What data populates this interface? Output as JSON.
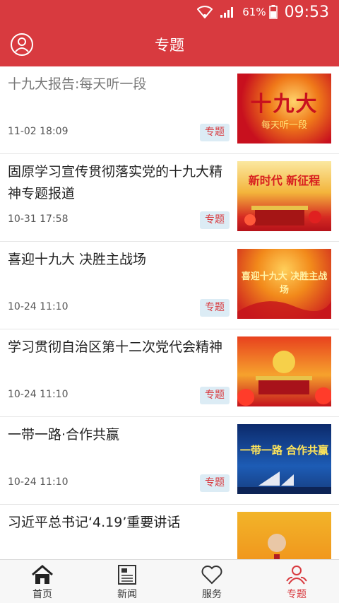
{
  "status_bar": {
    "battery_percent": "61%",
    "time": "09:53"
  },
  "header": {
    "title": "专题"
  },
  "thumb_text": {
    "t1_big": "十九大",
    "t1_small": "每天听一段",
    "t2_big": "新时代 新征程",
    "t3_big": "喜迎十九大 决胜主战场",
    "t5_big": "一带一路 合作共赢"
  },
  "articles": [
    {
      "title": "十九大报告:每天听一段",
      "date": "11-02 18:09",
      "tag": "专题",
      "read": true
    },
    {
      "title": "固原学习宣传贯彻落实党的十九大精神专题报道",
      "date": "10-31 17:58",
      "tag": "专题",
      "read": false
    },
    {
      "title": "喜迎十九大  决胜主战场",
      "date": "10-24 11:10",
      "tag": "专题",
      "read": false
    },
    {
      "title": "学习贯彻自治区第十二次党代会精神",
      "date": "10-24 11:10",
      "tag": "专题",
      "read": false
    },
    {
      "title": "一带一路·合作共赢",
      "date": "10-24 11:10",
      "tag": "专题",
      "read": false
    },
    {
      "title": "习近平总书记‘4.19’重要讲话",
      "date": "",
      "tag": "",
      "read": false
    }
  ],
  "tabs": [
    {
      "label": "首页",
      "icon": "home-icon",
      "active": false
    },
    {
      "label": "新闻",
      "icon": "news-icon",
      "active": false
    },
    {
      "label": "服务",
      "icon": "heart-icon",
      "active": false
    },
    {
      "label": "专题",
      "icon": "people-icon",
      "active": true
    }
  ],
  "colors": {
    "brand_red": "#d83a3f",
    "tag_bg": "#dcecf5",
    "active_tab": "#d83a3f"
  }
}
